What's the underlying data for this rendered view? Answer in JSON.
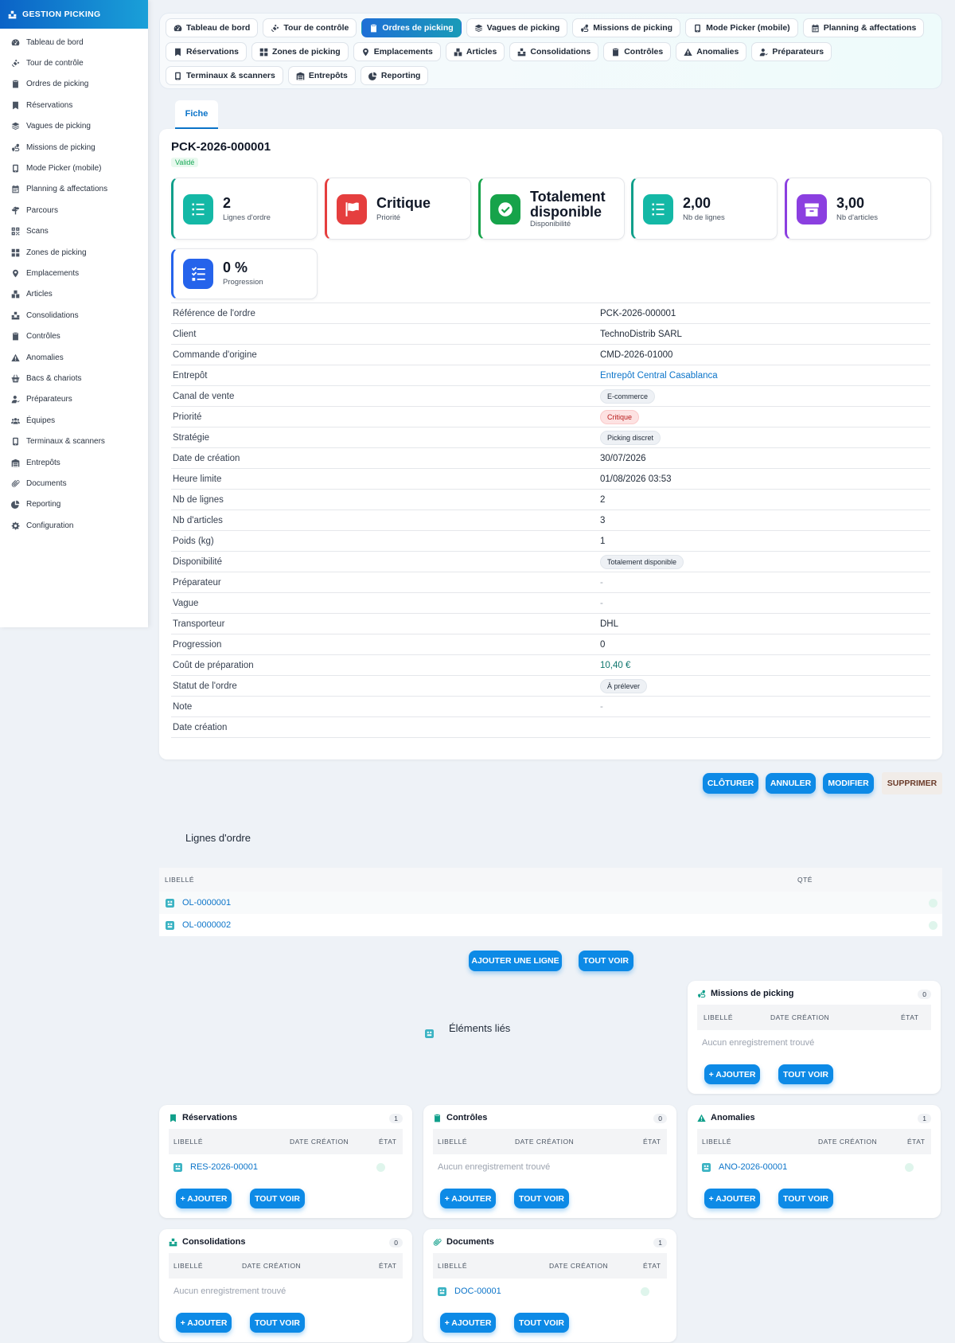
{
  "brand": "GESTION PICKING",
  "sidebar": {
    "items": [
      {
        "label": "Tableau de bord",
        "icon": "dashboard-icon"
      },
      {
        "label": "Tour de contrôle",
        "icon": "satellite-icon"
      },
      {
        "label": "Ordres de picking",
        "icon": "clipboard-icon"
      },
      {
        "label": "Réservations",
        "icon": "bookmark-icon"
      },
      {
        "label": "Vagues de picking",
        "icon": "layers-icon"
      },
      {
        "label": "Missions de picking",
        "icon": "route-icon"
      },
      {
        "label": "Mode Picker (mobile)",
        "icon": "mobile-icon"
      },
      {
        "label": "Planning & affectations",
        "icon": "calendar-icon"
      },
      {
        "label": "Parcours",
        "icon": "signs-icon"
      },
      {
        "label": "Scans",
        "icon": "qrcode-icon"
      },
      {
        "label": "Zones de picking",
        "icon": "grid-icon"
      },
      {
        "label": "Emplacements",
        "icon": "pin-icon"
      },
      {
        "label": "Articles",
        "icon": "boxes-icon"
      },
      {
        "label": "Consolidations",
        "icon": "cubes-icon"
      },
      {
        "label": "Contrôles",
        "icon": "clipboard-check-icon"
      },
      {
        "label": "Anomalies",
        "icon": "warning-icon"
      },
      {
        "label": "Bacs & chariots",
        "icon": "basket-icon"
      },
      {
        "label": "Préparateurs",
        "icon": "user-icon"
      },
      {
        "label": "Équipes",
        "icon": "users-icon"
      },
      {
        "label": "Terminaux & scanners",
        "icon": "mobile-icon"
      },
      {
        "label": "Entrepôts",
        "icon": "warehouse-icon"
      },
      {
        "label": "Documents",
        "icon": "paperclip-icon"
      },
      {
        "label": "Reporting",
        "icon": "pie-icon"
      },
      {
        "label": "Configuration",
        "icon": "gear-icon"
      }
    ]
  },
  "topnav": {
    "items": [
      {
        "label": "Tableau de bord",
        "icon": "dashboard-icon"
      },
      {
        "label": "Tour de contrôle",
        "icon": "satellite-icon"
      },
      {
        "label": "Ordres de picking",
        "icon": "clipboard-icon",
        "active": true
      },
      {
        "label": "Vagues de picking",
        "icon": "layers-icon"
      },
      {
        "label": "Missions de picking",
        "icon": "route-icon"
      },
      {
        "label": "Mode Picker (mobile)",
        "icon": "mobile-icon"
      },
      {
        "label": "Planning & affectations",
        "icon": "calendar-icon"
      },
      {
        "label": "Réservations",
        "icon": "bookmark-icon"
      },
      {
        "label": "Zones de picking",
        "icon": "grid-icon"
      },
      {
        "label": "Emplacements",
        "icon": "pin-icon"
      },
      {
        "label": "Articles",
        "icon": "boxes-icon"
      },
      {
        "label": "Consolidations",
        "icon": "cubes-icon"
      },
      {
        "label": "Contrôles",
        "icon": "clipboard-check-icon"
      },
      {
        "label": "Anomalies",
        "icon": "warning-icon"
      },
      {
        "label": "Préparateurs",
        "icon": "user-icon"
      },
      {
        "label": "Terminaux & scanners",
        "icon": "mobile-icon"
      },
      {
        "label": "Entrepôts",
        "icon": "warehouse-icon"
      },
      {
        "label": "Reporting",
        "icon": "pie-icon"
      }
    ]
  },
  "tab": {
    "label": "Fiche"
  },
  "order": {
    "title": "PCK-2026-000001",
    "status": "Validé"
  },
  "kpis": [
    {
      "value": "2",
      "label": "Lignes d'ordre",
      "color": "#14b8a6",
      "accent": "#0f9f8a",
      "icon": "list-icon"
    },
    {
      "value": "Critique",
      "label": "Priorité",
      "color": "#e53e3e",
      "accent": "#e53e3e",
      "icon": "flag-icon"
    },
    {
      "value": "Totalement disponible",
      "label": "Disponibilité",
      "color": "#16a34a",
      "accent": "#16a34a",
      "icon": "check-circle-icon"
    },
    {
      "value": "2,00",
      "label": "Nb de lignes",
      "color": "#14b8a6",
      "accent": "#0f9f8a",
      "icon": "list-icon"
    },
    {
      "value": "3,00",
      "label": "Nb d'articles",
      "color": "#8b3fe0",
      "accent": "#8b3fe0",
      "icon": "box-icon"
    },
    {
      "value": "0 %",
      "label": "Progression",
      "color": "#2563eb",
      "accent": "#2563eb",
      "icon": "tasks-icon"
    }
  ],
  "details": [
    {
      "key": "Référence de l'ordre",
      "value": "PCK-2026-000001",
      "type": "text"
    },
    {
      "key": "Client",
      "value": "TechnoDistrib SARL",
      "type": "text"
    },
    {
      "key": "Commande d'origine",
      "value": "CMD-2026-01000",
      "type": "text"
    },
    {
      "key": "Entrepôt",
      "value": "Entrepôt Central Casablanca",
      "type": "link"
    },
    {
      "key": "Canal de vente",
      "value": "E-commerce",
      "type": "pill"
    },
    {
      "key": "Priorité",
      "value": "Critique",
      "type": "pill-red"
    },
    {
      "key": "Stratégie",
      "value": "Picking discret",
      "type": "pill"
    },
    {
      "key": "Date de création",
      "value": "30/07/2026",
      "type": "text"
    },
    {
      "key": "Heure limite",
      "value": "01/08/2026 03:53",
      "type": "text"
    },
    {
      "key": "Nb de lignes",
      "value": "2",
      "type": "text"
    },
    {
      "key": "Nb d'articles",
      "value": "3",
      "type": "text"
    },
    {
      "key": "Poids (kg)",
      "value": "1",
      "type": "text"
    },
    {
      "key": "Disponibilité",
      "value": "Totalement disponible",
      "type": "pill"
    },
    {
      "key": "Préparateur",
      "value": "-",
      "type": "muted"
    },
    {
      "key": "Vague",
      "value": "-",
      "type": "muted"
    },
    {
      "key": "Transporteur",
      "value": "DHL",
      "type": "text"
    },
    {
      "key": "Progression",
      "value": "0",
      "type": "text"
    },
    {
      "key": "Coût de préparation",
      "value": "10,40 €",
      "type": "money"
    },
    {
      "key": "Statut de l'ordre",
      "value": "À prélever",
      "type": "pill"
    },
    {
      "key": "Note",
      "value": "-",
      "type": "muted"
    },
    {
      "key": "Date création",
      "value": "",
      "type": "text"
    }
  ],
  "actions": {
    "cloturer": "CLÔTURER",
    "annuler": "ANNULER",
    "modifier": "MODIFIER",
    "supprimer": "SUPPRIMER"
  },
  "lignes": {
    "title": "Lignes d'ordre",
    "col_libelle": "LIBELLÉ",
    "col_qte": "QTÉ",
    "rows": [
      "OL-0000001",
      "OL-0000002"
    ],
    "add_label": "AJOUTER UNE LIGNE",
    "all_label": "TOUT VOIR"
  },
  "elements_title": "Éléments liés",
  "related_common": {
    "col_libelle": "LIBELLÉ",
    "col_date": "DATE CRÉATION",
    "col_etat": "ÉTAT",
    "empty": "Aucun enregistrement trouvé",
    "add": "+ AJOUTER",
    "all": "TOUT VOIR"
  },
  "related": [
    {
      "title": "Missions de picking",
      "count": "0",
      "icon": "route-icon",
      "item": ""
    },
    {
      "title": "Réservations",
      "count": "1",
      "icon": "bookmark-icon",
      "item": "RES-2026-00001"
    },
    {
      "title": "Contrôles",
      "count": "0",
      "icon": "clipboard-check-icon",
      "item": ""
    },
    {
      "title": "Anomalies",
      "count": "1",
      "icon": "warning-icon",
      "item": "ANO-2026-00001"
    },
    {
      "title": "Consolidations",
      "count": "0",
      "icon": "cubes-icon",
      "item": ""
    },
    {
      "title": "Documents",
      "count": "1",
      "icon": "paperclip-icon",
      "item": "DOC-00001"
    }
  ],
  "colors": {
    "primary": "#0d8ae6",
    "link": "#0b74c9",
    "sidebar_brand": "#0b63c7"
  }
}
